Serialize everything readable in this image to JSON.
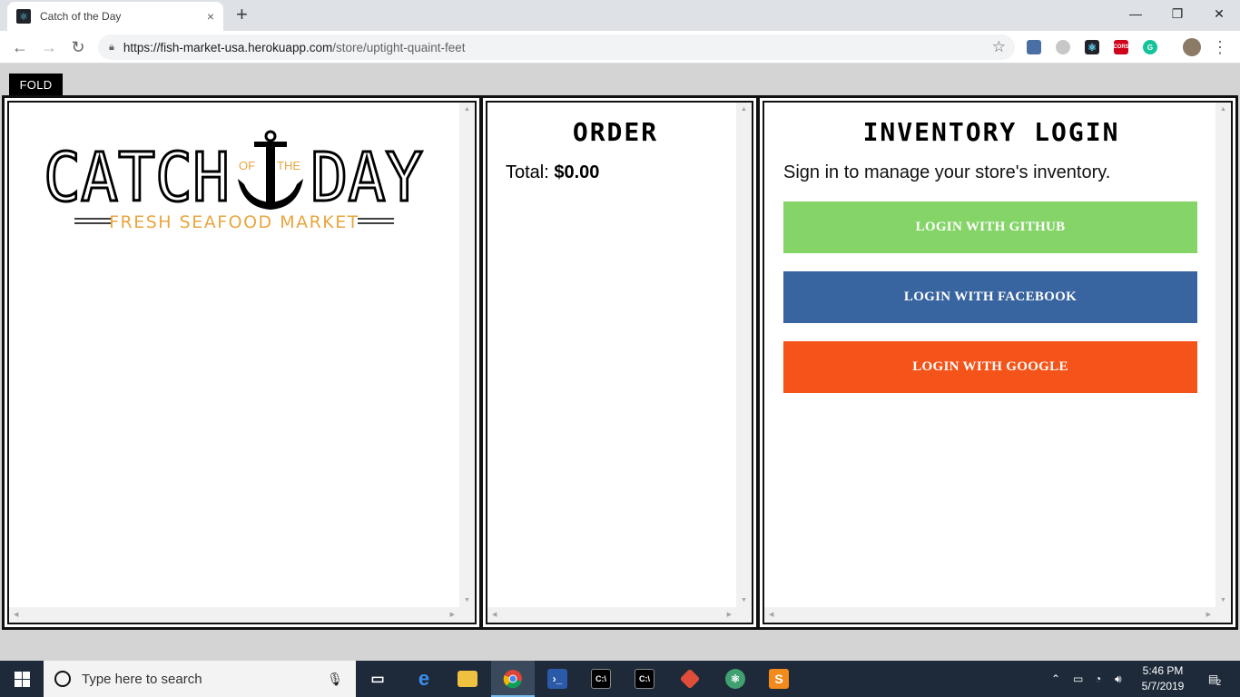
{
  "browser": {
    "tab_title": "Catch of the Day",
    "tab_close": "×",
    "new_tab": "+",
    "url_host": "https://fish-market-usa.herokuapp.com",
    "url_path": "/store/uptight-quaint-feet",
    "win_minimize": "—",
    "win_restore": "❐",
    "win_close": "✕",
    "ext_cors": "CORS"
  },
  "page": {
    "fold_label": "FOLD",
    "logo": {
      "left_text": "CATCH",
      "right_text": "DAY",
      "of_text": "OF",
      "the_text": "THE",
      "tagline": "FRESH SEAFOOD MARKET"
    },
    "order": {
      "title": "ORDER",
      "total_label": "Total:",
      "total_value": "$0.00"
    },
    "inventory": {
      "title": "INVENTORY LOGIN",
      "subtitle": "Sign in to manage your store's inventory.",
      "buttons": [
        {
          "label": "LOGIN WITH GITHUB",
          "color": "#84d468"
        },
        {
          "label": "LOGIN WITH FACEBOOK",
          "color": "#3864a0"
        },
        {
          "label": "LOGIN WITH GOOGLE",
          "color": "#f4541a"
        }
      ]
    }
  },
  "colors": {
    "logo_accent": "#e8a640",
    "taskbar": "#1e2a3a"
  },
  "taskbar": {
    "search_placeholder": "Type here to search",
    "time": "5:46 PM",
    "date": "5/7/2019",
    "notification_count": "2"
  }
}
